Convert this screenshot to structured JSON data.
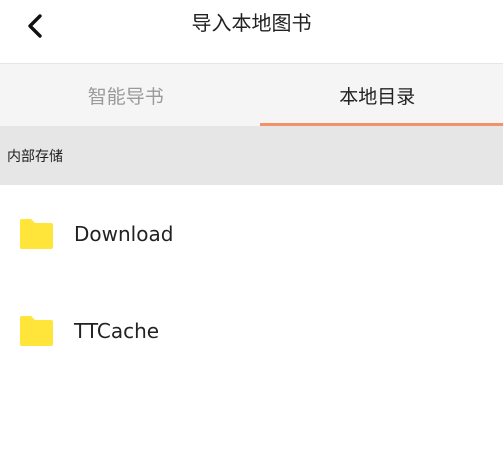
{
  "header": {
    "title": "导入本地图书",
    "back_icon": "chevron-left-icon"
  },
  "tabs": [
    {
      "label": "智能导书",
      "active": false
    },
    {
      "label": "本地目录",
      "active": true
    }
  ],
  "colors": {
    "accent": "#f2926a",
    "folder": "#ffe43a",
    "section_bg": "#e6e6e6",
    "tab_bg": "#f5f5f5"
  },
  "section": {
    "label": "内部存储"
  },
  "folders": [
    {
      "name": "Download",
      "icon": "folder-icon"
    },
    {
      "name": "TTCache",
      "icon": "folder-icon"
    }
  ]
}
